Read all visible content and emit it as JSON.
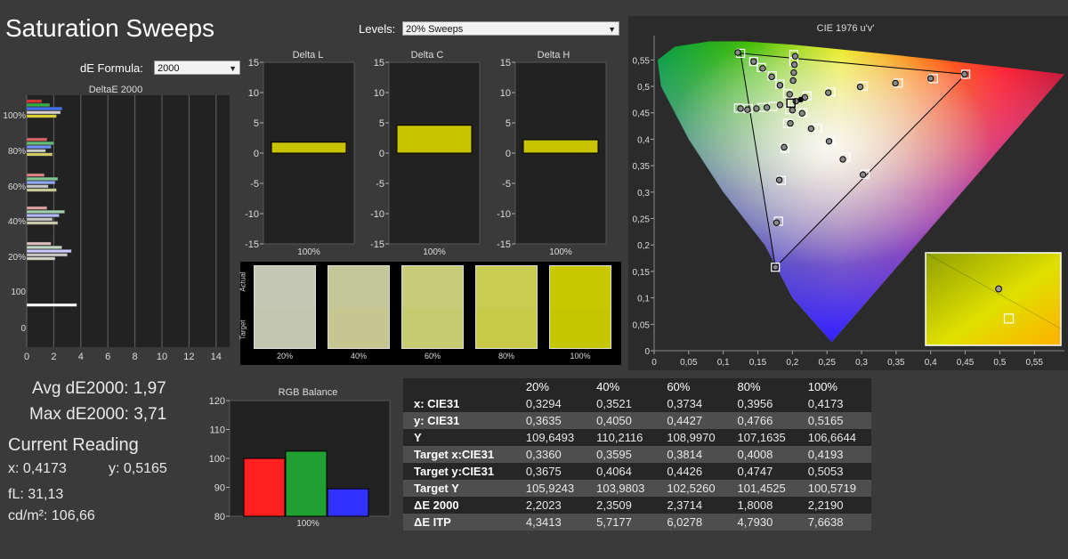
{
  "page": {
    "title": "Saturation Sweeps"
  },
  "levels": {
    "label": "Levels:",
    "value": "20% Sweeps"
  },
  "formula": {
    "label": "dE Formula:",
    "value": "2000"
  },
  "stats": {
    "avg": "Avg dE2000: 1,97",
    "max": "Max dE2000: 3,71",
    "current_heading": "Current Reading",
    "x": "x: 0,4173",
    "y": "y: 0,5165",
    "fl": "fL: 31,13",
    "cdm2": "cd/m²: 106,66"
  },
  "colors": {
    "accent_yellow": "#c8c400",
    "red": "#ff2020",
    "green": "#20a030",
    "blue": "#3030ff"
  },
  "chart_data": [
    {
      "type": "bar",
      "title": "DeltaE 2000",
      "orientation": "horizontal",
      "categories": [
        "100%",
        "80%",
        "60%",
        "40%",
        "20%",
        "100"
      ],
      "xlim": [
        0,
        15
      ],
      "xticks": [
        "0",
        "2",
        "4",
        "6",
        "8",
        "10",
        "12",
        "14"
      ],
      "yticks": [
        "100%",
        "80%",
        "60%",
        "40%",
        "20%",
        "100",
        "0"
      ],
      "groups": [
        {
          "category": "100%",
          "values": [
            1.1,
            1.7,
            2.6,
            2.5,
            2.2
          ],
          "colors": [
            "#e03030",
            "#30b040",
            "#3a70ff",
            "#d0d0d0",
            "#d8d030"
          ]
        },
        {
          "category": "80%",
          "values": [
            1.5,
            2.0,
            1.8,
            1.4,
            1.9
          ],
          "colors": [
            "#e06060",
            "#60c070",
            "#7090ff",
            "#c8c8c8",
            "#d0cc60"
          ]
        },
        {
          "category": "60%",
          "values": [
            1.3,
            2.3,
            2.1,
            1.6,
            2.2
          ],
          "colors": [
            "#e08080",
            "#80c890",
            "#90a8ff",
            "#c8c8c8",
            "#c8c890"
          ]
        },
        {
          "category": "40%",
          "values": [
            1.5,
            2.8,
            2.4,
            1.9,
            2.3
          ],
          "colors": [
            "#e0a0a0",
            "#a0d0a8",
            "#b0b8ff",
            "#c8c8c8",
            "#c8c8a8"
          ]
        },
        {
          "category": "20%",
          "values": [
            1.8,
            2.6,
            3.3,
            3.0,
            2.1
          ],
          "colors": [
            "#e0c0c0",
            "#c0d8c0",
            "#c8c8ff",
            "#c8c8c8",
            "#d0d0c0"
          ]
        },
        {
          "category": "100",
          "values": [
            3.7
          ],
          "colors": [
            "#ffffff"
          ]
        }
      ]
    },
    {
      "type": "bar",
      "title": "Delta L",
      "categories": [
        "100%"
      ],
      "values": [
        1.8
      ],
      "ylim": [
        -15,
        15
      ],
      "yticks": [
        "15",
        "10",
        "5",
        "0",
        "-5",
        "-10",
        "-15"
      ]
    },
    {
      "type": "bar",
      "title": "Delta C",
      "categories": [
        "100%"
      ],
      "values": [
        4.6
      ],
      "ylim": [
        -15,
        15
      ],
      "yticks": [
        "15",
        "10",
        "5",
        "0",
        "-5",
        "-10",
        "-15"
      ]
    },
    {
      "type": "bar",
      "title": "Delta H",
      "categories": [
        "100%"
      ],
      "values": [
        2.2
      ],
      "ylim": [
        -15,
        15
      ],
      "yticks": [
        "15",
        "10",
        "5",
        "0",
        "-5",
        "-10",
        "-15"
      ]
    },
    {
      "type": "bar",
      "title": "RGB Balance",
      "categories": [
        "100%"
      ],
      "series": [
        {
          "values": [
            100
          ]
        },
        {
          "values": [
            102.5
          ]
        },
        {
          "values": [
            89.5
          ]
        }
      ],
      "series_colors": [
        "#ff2020",
        "#20a030",
        "#3030ff"
      ],
      "ylim": [
        80,
        120
      ],
      "yticks": [
        "120",
        "110",
        "100",
        "90",
        "80"
      ]
    },
    {
      "type": "scatter",
      "title": "CIE 1976 u'v'",
      "xlim": [
        0,
        0.6
      ],
      "ylim": [
        0,
        0.6
      ],
      "xticks": [
        "0",
        "0,05",
        "0,1",
        "0,15",
        "0,2",
        "0,25",
        "0,3",
        "0,35",
        "0,4",
        "0,45",
        "0,5",
        "0,55"
      ],
      "yticks": [
        "0,55",
        "0,5",
        "0,45",
        "0,4",
        "0,35",
        "0,3",
        "0,25",
        "0,2",
        "0,15",
        "0,1",
        "0,05",
        "0"
      ],
      "gamut_triangle": [
        [
          0.4507,
          0.5229
        ],
        [
          0.125,
          0.5625
        ],
        [
          0.1754,
          0.1579
        ]
      ],
      "white_point": [
        0.1978,
        0.4683
      ],
      "targets": [
        [
          0.2211,
          0.4819
        ],
        [
          0.2557,
          0.4896
        ],
        [
          0.3022,
          0.5003
        ],
        [
          0.3533,
          0.5064
        ],
        [
          0.4041,
          0.5146
        ],
        [
          0.4507,
          0.5229
        ],
        [
          0.193,
          0.4862
        ],
        [
          0.182,
          0.5043
        ],
        [
          0.1707,
          0.5199
        ],
        [
          0.155,
          0.5355
        ],
        [
          0.144,
          0.547
        ],
        [
          0.125,
          0.5625
        ],
        [
          0.196,
          0.456
        ],
        [
          0.193,
          0.43
        ],
        [
          0.189,
          0.383
        ],
        [
          0.184,
          0.322
        ],
        [
          0.18,
          0.245
        ],
        [
          0.1754,
          0.1579
        ],
        [
          0.2,
          0.471
        ],
        [
          0.172,
          0.462
        ],
        [
          0.156,
          0.46
        ],
        [
          0.136,
          0.458
        ],
        [
          0.122,
          0.459
        ],
        [
          0.215,
          0.45
        ],
        [
          0.236,
          0.421
        ],
        [
          0.255,
          0.398
        ],
        [
          0.277,
          0.366
        ],
        [
          0.305,
          0.334
        ],
        [
          0.202,
          0.547
        ],
        [
          0.202,
          0.56
        ]
      ],
      "measured": [
        [
          0.218,
          0.479
        ],
        [
          0.252,
          0.488
        ],
        [
          0.298,
          0.499
        ],
        [
          0.349,
          0.506
        ],
        [
          0.4,
          0.515
        ],
        [
          0.449,
          0.523
        ],
        [
          0.196,
          0.485
        ],
        [
          0.182,
          0.502
        ],
        [
          0.17,
          0.518
        ],
        [
          0.157,
          0.534
        ],
        [
          0.144,
          0.547
        ],
        [
          0.121,
          0.564
        ],
        [
          0.2,
          0.455
        ],
        [
          0.197,
          0.43
        ],
        [
          0.188,
          0.385
        ],
        [
          0.181,
          0.323
        ],
        [
          0.177,
          0.242
        ],
        [
          0.1754,
          0.1579
        ],
        [
          0.205,
          0.472
        ],
        [
          0.182,
          0.465
        ],
        [
          0.163,
          0.46
        ],
        [
          0.148,
          0.458
        ],
        [
          0.135,
          0.456
        ],
        [
          0.125,
          0.458
        ],
        [
          0.214,
          0.449
        ],
        [
          0.227,
          0.42
        ],
        [
          0.253,
          0.396
        ],
        [
          0.273,
          0.362
        ],
        [
          0.302,
          0.333
        ],
        [
          0.201,
          0.511
        ],
        [
          0.202,
          0.526
        ],
        [
          0.203,
          0.541
        ],
        [
          0.204,
          0.557
        ]
      ],
      "current": [
        0.212,
        0.475
      ],
      "inset": {
        "target": [
          0.615,
          0.71
        ],
        "measured": [
          0.54,
          0.39
        ]
      }
    }
  ],
  "swatches": {
    "actual_label": "Actual",
    "target_label": "Target",
    "items": [
      {
        "label": "20%",
        "actual": "#c4c8b4",
        "target": "#c2c6b0"
      },
      {
        "label": "40%",
        "actual": "#c4c898",
        "target": "#c4c890"
      },
      {
        "label": "60%",
        "actual": "#c8cc78",
        "target": "#c6ca70"
      },
      {
        "label": "80%",
        "actual": "#c8cc50",
        "target": "#c6ca48"
      },
      {
        "label": "100%",
        "actual": "#c8c800",
        "target": "#c6c600"
      }
    ]
  },
  "table": {
    "columns": [
      "",
      "20%",
      "40%",
      "60%",
      "80%",
      "100%"
    ],
    "rows": [
      [
        "x: CIE31",
        "0,3294",
        "0,3521",
        "0,3734",
        "0,3956",
        "0,4173"
      ],
      [
        "y: CIE31",
        "0,3635",
        "0,4050",
        "0,4427",
        "0,4766",
        "0,5165"
      ],
      [
        "Y",
        "109,6493",
        "110,2116",
        "108,9970",
        "107,1635",
        "106,6644"
      ],
      [
        "Target x:CIE31",
        "0,3360",
        "0,3595",
        "0,3814",
        "0,4008",
        "0,4193"
      ],
      [
        "Target y:CIE31",
        "0,3675",
        "0,4064",
        "0,4426",
        "0,4747",
        "0,5053"
      ],
      [
        "Target Y",
        "105,9243",
        "103,9803",
        "102,5260",
        "101,4525",
        "100,5719"
      ],
      [
        "ΔE 2000",
        "2,2023",
        "2,3509",
        "2,3714",
        "1,8008",
        "2,2190"
      ],
      [
        "ΔE ITP",
        "4,3413",
        "5,7177",
        "6,0278",
        "4,7930",
        "7,6638"
      ]
    ]
  }
}
